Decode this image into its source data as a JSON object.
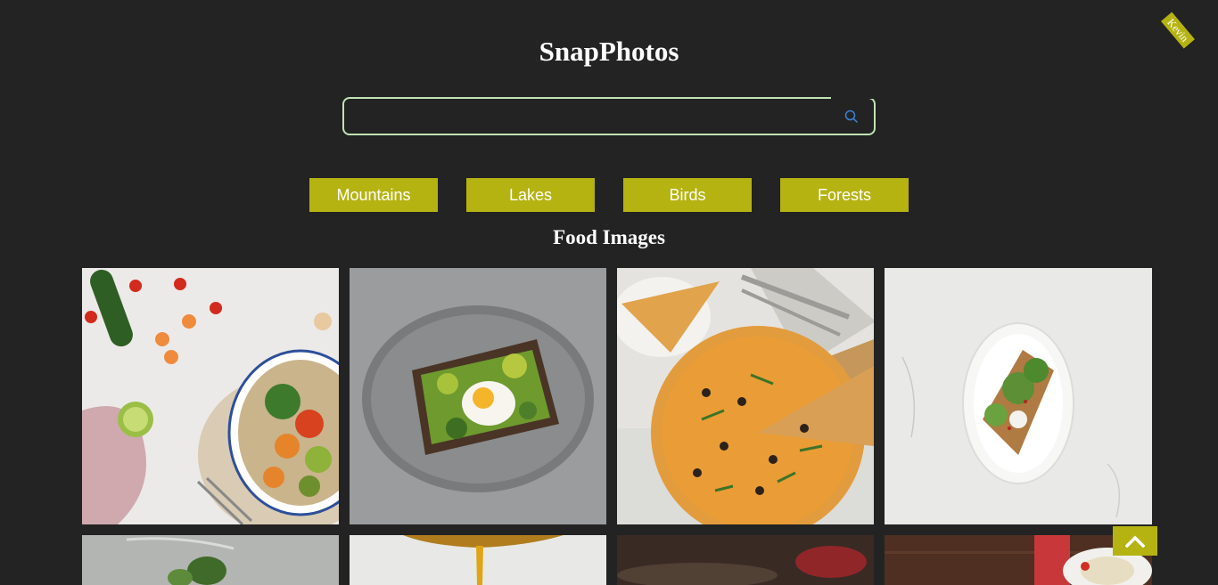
{
  "app": {
    "title": "SnapPhotos",
    "ribbon_text": "Kevin"
  },
  "search": {
    "value": "",
    "placeholder": "",
    "icon": "search-icon"
  },
  "categories": [
    {
      "label": "Mountains"
    },
    {
      "label": "Lakes"
    },
    {
      "label": "Birds"
    },
    {
      "label": "Forests"
    }
  ],
  "section": {
    "title": "Food Images"
  },
  "photos": [
    {
      "subject": "vegetable bowl"
    },
    {
      "subject": "avocado toast with egg"
    },
    {
      "subject": "pizza"
    },
    {
      "subject": "toast on white plate"
    },
    {
      "subject": "salad on fork"
    },
    {
      "subject": "honey drizzle"
    },
    {
      "subject": "blurred food"
    },
    {
      "subject": "noodles on wooden table"
    }
  ],
  "scroll_top": {
    "icon": "chevron-up-icon"
  },
  "colors": {
    "background": "#232323",
    "accent": "#b5b312",
    "search_border": "#bfe3b5"
  }
}
